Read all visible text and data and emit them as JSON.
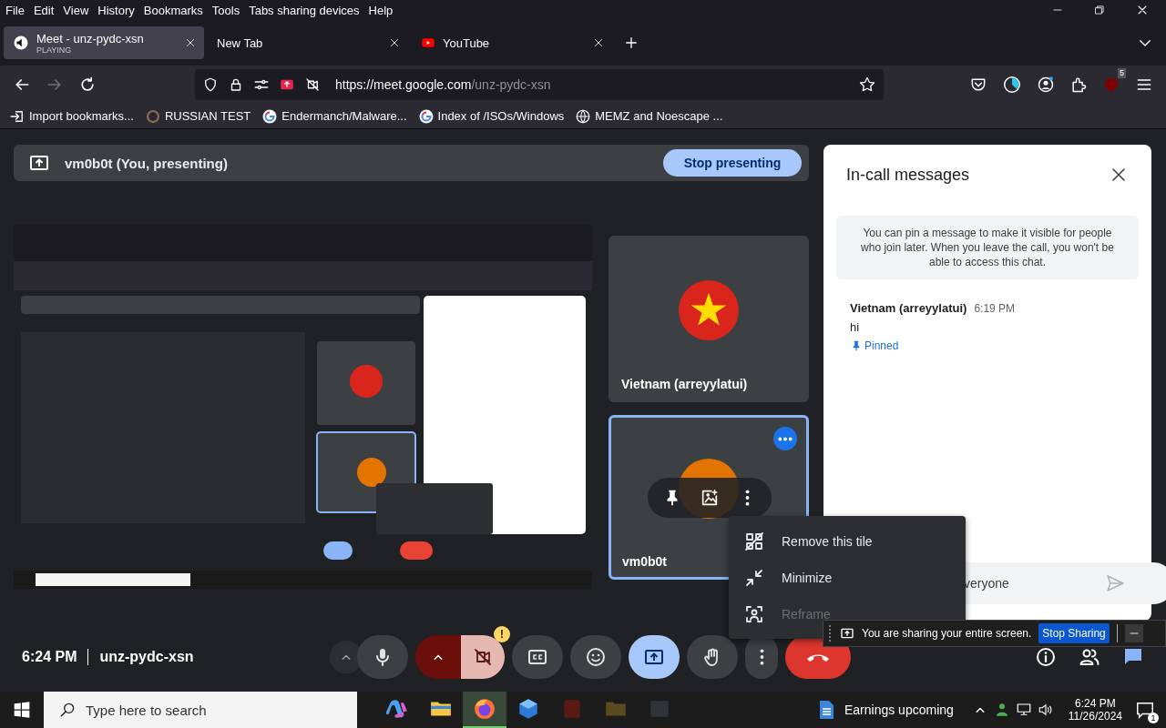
{
  "menu_bar": [
    "File",
    "Edit",
    "View",
    "History",
    "Bookmarks",
    "Tools",
    "Tabs sharing devices",
    "Help"
  ],
  "tabs": [
    {
      "title": "Meet - unz-pydc-xsn",
      "subtitle": "PLAYING",
      "kind": "meet",
      "selected": true
    },
    {
      "title": "New Tab",
      "kind": "blank",
      "selected": false
    },
    {
      "title": "YouTube",
      "kind": "youtube",
      "selected": false
    }
  ],
  "address_bar": {
    "url_host": "https://meet.google.com",
    "url_path": "/unz-pydc-xsn"
  },
  "extension_badge": "5",
  "bookmarks": [
    {
      "label": "Import bookmarks...",
      "kind": "import"
    },
    {
      "label": "RUSSIAN TEST",
      "kind": "site"
    },
    {
      "label": "Endermanch/Malware...",
      "kind": "google"
    },
    {
      "label": "Index of /ISOs/Windows",
      "kind": "google"
    },
    {
      "label": "MEMZ and Noescape ...",
      "kind": "globe"
    }
  ],
  "presenting_banner": {
    "label": "vm0b0t (You, presenting)",
    "button": "Stop presenting"
  },
  "shared_screen": {
    "kind": "picture"
  },
  "tiles": [
    {
      "name": "Vietnam (arreyylatui)",
      "kind": "star",
      "selected": false
    },
    {
      "name": "vm0b0t",
      "kind": "plain",
      "selected": true
    }
  ],
  "tile_menu": [
    {
      "label": "Remove this tile",
      "kind": "remove",
      "disabled": false
    },
    {
      "label": "Minimize",
      "kind": "minimize",
      "disabled": false
    },
    {
      "label": "Reframe",
      "kind": "reframe",
      "disabled": true
    }
  ],
  "chat": {
    "title": "In-call messages",
    "notice": "You can pin a message to make it visible for people who join later. When you leave the call, you won't be able to access this chat.",
    "messages": [
      {
        "author": "Vietnam (arreyylatui)",
        "time": "6:19 PM",
        "text": "hi",
        "pinned_label": "Pinned"
      }
    ],
    "input_placeholder": "veryone"
  },
  "sharing_bar": {
    "text": "You are sharing your entire screen.",
    "button": "Stop Sharing"
  },
  "meeting_info": {
    "time": "6:24 PM",
    "code": "unz-pydc-xsn"
  },
  "controls": [
    {
      "kind": "expand"
    },
    {
      "kind": "mic",
      "on": true
    },
    {
      "kind": "camera",
      "on": false,
      "alert": "!"
    },
    {
      "kind": "captions",
      "on": false
    },
    {
      "kind": "reactions"
    },
    {
      "kind": "present",
      "on": true
    },
    {
      "kind": "hand",
      "on": false
    },
    {
      "kind": "more"
    },
    {
      "kind": "leave"
    }
  ],
  "side_controls": [
    {
      "kind": "info",
      "selected": false
    },
    {
      "kind": "people",
      "selected": false
    },
    {
      "kind": "chat",
      "selected": true
    }
  ],
  "taskbar": {
    "search_placeholder": "Type here to search",
    "apps": [
      {
        "kind": "copilot",
        "selected": false
      },
      {
        "kind": "explorer",
        "selected": false
      },
      {
        "kind": "firefox",
        "selected": true
      },
      {
        "kind": "tool",
        "selected": false
      },
      {
        "kind": "red-app",
        "selected": false
      },
      {
        "kind": "folder",
        "selected": false
      },
      {
        "kind": "window",
        "selected": false
      }
    ],
    "weather": "Earnings upcoming",
    "time": "6:24 PM",
    "date": "11/26/2024",
    "notifications": "1"
  }
}
